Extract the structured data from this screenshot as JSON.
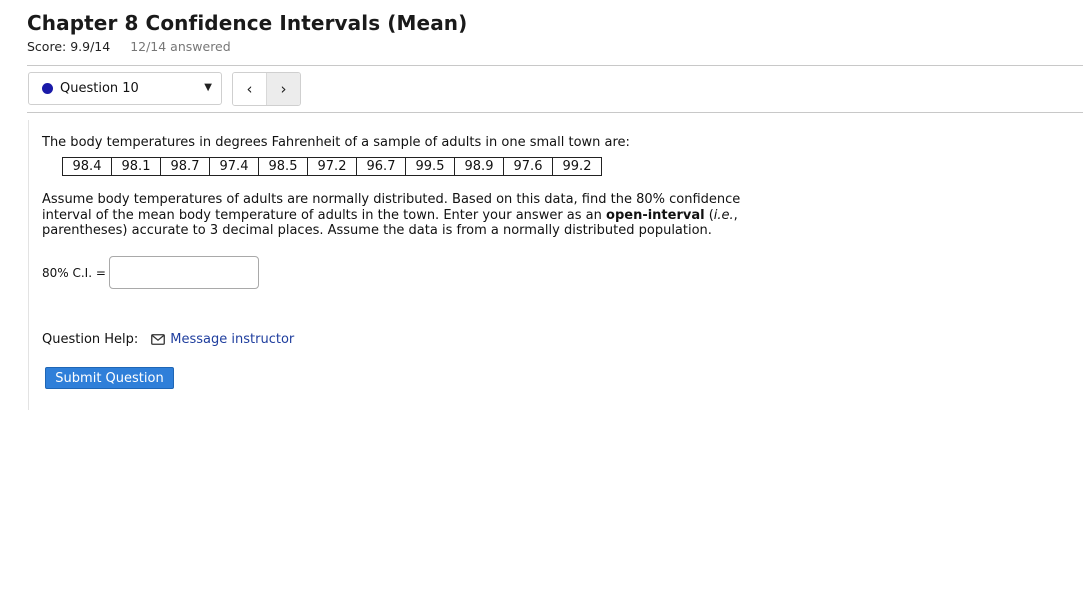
{
  "page": {
    "title": "Chapter 8 Confidence Intervals (Mean)",
    "score": "Score: 9.9/14",
    "answered": "12/14 answered"
  },
  "question_nav": {
    "selected": "Question 10",
    "prev": "‹",
    "next": "›",
    "status_color": "#1a1aa8"
  },
  "question": {
    "intro": "The body temperatures in degrees Fahrenheit of a sample of adults in one small town are:",
    "data": [
      "98.4",
      "98.1",
      "98.7",
      "97.4",
      "98.5",
      "97.2",
      "96.7",
      "99.5",
      "98.9",
      "97.6",
      "99.2"
    ],
    "para_1": "Assume body temperatures of adults are normally distributed. Based on this data, find the 80% confidence interval of the mean body temperature of adults in the town. Enter your answer as an ",
    "para_bold": "open-interval",
    "para_2": " (",
    "para_italic": "i.e.",
    "para_3": ", parentheses) accurate to 3 decimal places. Assume the data is from a normally distributed population.",
    "ci_label": "80% C.I. =",
    "ci_value": ""
  },
  "help": {
    "label": "Question Help:",
    "message_link": "Message instructor"
  },
  "submit_label": "Submit Question",
  "colors": {
    "submit": "#2f7fd9",
    "link": "#1f3e9e"
  }
}
